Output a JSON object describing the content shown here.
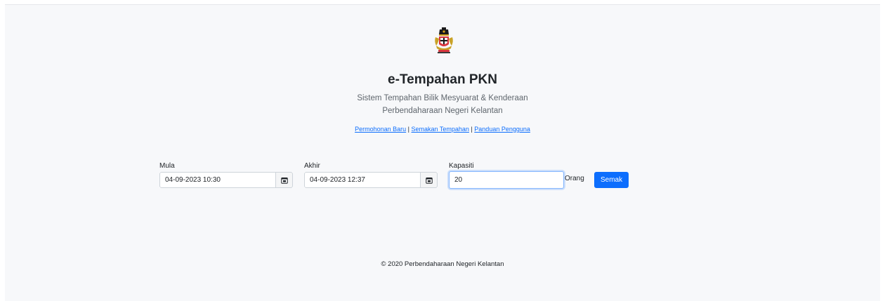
{
  "header": {
    "title": "e-Tempahan PKN",
    "subtitle_line1": "Sistem Tempahan Bilik Mesyuarat & Kenderaan",
    "subtitle_line2": "Perbendaharaan Negeri Kelantan"
  },
  "nav": {
    "link1": "Permohonan Baru",
    "link2": "Semakan Tempahan",
    "link3": "Panduan Pengguna",
    "separator": "|"
  },
  "form": {
    "start_label": "Mula",
    "start_value": "04-09-2023 10:30",
    "end_label": "Akhir",
    "end_value": "04-09-2023 12:37",
    "capacity_label": "Kapasiti",
    "capacity_value": "20",
    "capacity_unit": "Orang",
    "submit_label": "Semak"
  },
  "footer": {
    "text": "© 2020 Perbendaharaan Negeri Kelantan"
  },
  "colors": {
    "primary": "#0d6efd",
    "background": "#f7f8fa",
    "link": "#0d6efd"
  },
  "icons": {
    "crest": "state-crest-logo",
    "calendar": "calendar-icon"
  }
}
